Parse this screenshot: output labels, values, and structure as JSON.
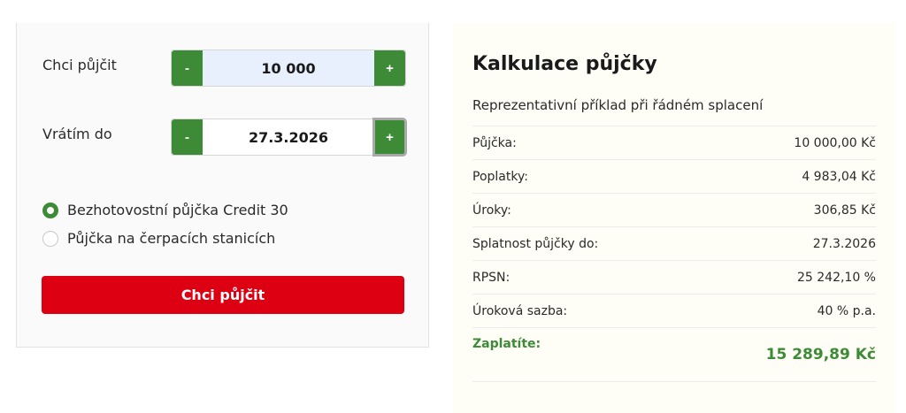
{
  "form": {
    "amount_label": "Chci půjčit",
    "amount_value": "10 000",
    "date_label": "Vrátím do",
    "date_value": "27.3.2026",
    "minus": "-",
    "plus": "+",
    "options": [
      {
        "label": "Bezhotovostní půjčka Credit 30",
        "selected": true
      },
      {
        "label": "Půjčka na čerpacích stanicích",
        "selected": false
      }
    ],
    "submit_label": "Chci půjčit"
  },
  "summary": {
    "title": "Kalkulace půjčky",
    "subtitle": "Reprezentativní příklad při řádném splacení",
    "rows": [
      {
        "label": "Půjčka:",
        "value": "10 000,00 Kč"
      },
      {
        "label": "Poplatky:",
        "value": "4 983,04 Kč"
      },
      {
        "label": "Úroky:",
        "value": "306,85 Kč"
      },
      {
        "label": "Splatnost půjčky do:",
        "value": "27.3.2026"
      },
      {
        "label": "RPSN:",
        "value": "25 242,10 %"
      },
      {
        "label": "Úroková sazba:",
        "value": "40 % p.a."
      }
    ],
    "total": {
      "label": "Zaplatíte:",
      "value": "15 289,89 Kč"
    }
  },
  "colors": {
    "accent_green": "#3d8b37",
    "cta_red": "#dc0012",
    "amount_field_bg": "#e8f0fd"
  }
}
